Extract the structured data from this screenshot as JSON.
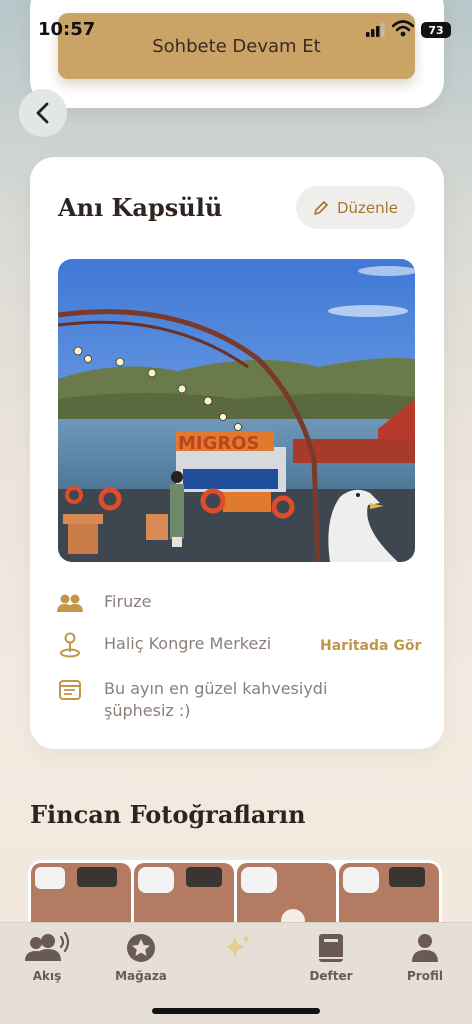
{
  "status": {
    "time": "10:57",
    "battery": "73"
  },
  "top_card": {
    "button_label": "Sohbete Devam Et"
  },
  "memory_card": {
    "title": "Anı Kapsülü",
    "edit_label": "Düzenle",
    "photo_sign": "MIGROS",
    "person": "Firuze",
    "location": "Haliç Kongre Merkezi",
    "map_link": "Haritada Gör",
    "note_line1": "Bu ayın en güzel kahvesiydi",
    "note_line2": "şüphesiz :)"
  },
  "section": {
    "title": "Fincan Fotoğrafların"
  },
  "tabs": [
    {
      "label": "Akış",
      "icon": "people-wave-icon"
    },
    {
      "label": "Mağaza",
      "icon": "star-circle-icon"
    },
    {
      "label": "",
      "icon": "sparkle-icon"
    },
    {
      "label": "Defter",
      "icon": "book-icon"
    },
    {
      "label": "Profil",
      "icon": "person-icon"
    }
  ],
  "colors": {
    "accent": "#c9a466",
    "accent_text": "#c29649",
    "card_bg": "#ffffff",
    "tab_bg": "#e6dfd8"
  }
}
